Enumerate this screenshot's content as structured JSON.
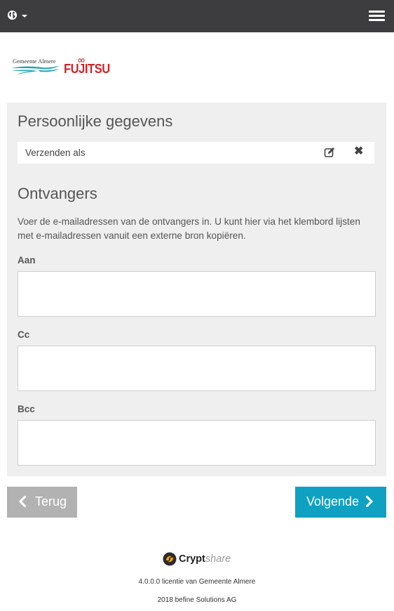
{
  "navbar": {
    "language_icon": "globe-icon",
    "menu_icon": "hamburger-icon"
  },
  "logos": {
    "almere_text": "Gemeente Almere",
    "fujitsu_text": "FUJITSU",
    "brand_red": "#d2232a",
    "almere_teal": "#1fa3b8"
  },
  "personal": {
    "heading": "Persoonlijke gegevens",
    "sender_label": "Verzenden als",
    "edit_icon": "edit-icon",
    "close_icon": "close-icon"
  },
  "recipients": {
    "heading": "Ontvangers",
    "description": "Voer de e-mailadressen van de ontvangers in. U kunt hier via het klembord lijsten met e-mailadressen vanuit een externe bron kopiëren.",
    "fields": [
      {
        "label": "Aan",
        "value": ""
      },
      {
        "label": "Cc",
        "value": ""
      },
      {
        "label": "Bcc",
        "value": ""
      }
    ]
  },
  "actions": {
    "back_label": "Terug",
    "next_label": "Volgende",
    "back_color": "#b2b2b2",
    "next_color": "#0fa1c2"
  },
  "footer": {
    "brand_main": "Crypt",
    "brand_sub": "share",
    "license": "4.0.0.0 licentie van Gemeente Almere",
    "copyright": "2018 befine Solutions AG"
  }
}
